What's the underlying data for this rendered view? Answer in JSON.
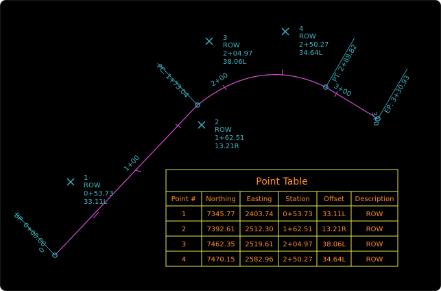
{
  "colors": {
    "background": "#000000",
    "frame": "#1a1a1a",
    "alignment": "#d94fd6",
    "label": "#3fb8c4",
    "table_border": "#e8e84a",
    "table_text": "#ff8c28"
  },
  "alignment": {
    "begin_label": "BP: 0+00.00",
    "begin_zero": "0",
    "pc_label": "PC: 1+73.04",
    "pt_label": "PT: 2+88.82",
    "ep_label": "EP: 3+30.93",
    "pt_tick_label": "3+00",
    "ep_tick_label": "3+0",
    "tick_labels": [
      "1+00",
      "2+00"
    ]
  },
  "points": [
    {
      "num": "1",
      "desc": "ROW",
      "station": "0+53.73",
      "offset": "33.11L"
    },
    {
      "num": "2",
      "desc": "ROW",
      "station": "1+62.51",
      "offset": "13.21R"
    },
    {
      "num": "3",
      "desc": "ROW",
      "station": "2+04.97",
      "offset": "38.06L"
    },
    {
      "num": "4",
      "desc": "ROW",
      "station": "2+50.27",
      "offset": "34.64L"
    }
  ],
  "point_table": {
    "title": "Point Table",
    "headers": [
      "Point #",
      "Northing",
      "Easting",
      "Station",
      "Offset",
      "Description"
    ],
    "rows": [
      [
        "1",
        "7345.77",
        "2403.74",
        "0+53.73",
        "33.11L",
        "ROW"
      ],
      [
        "2",
        "7392.61",
        "2512.30",
        "1+62.51",
        "13.21R",
        "ROW"
      ],
      [
        "3",
        "7462.35",
        "2519.61",
        "2+04.97",
        "38.06L",
        "ROW"
      ],
      [
        "4",
        "7470.15",
        "2582.96",
        "2+50.27",
        "34.64L",
        "ROW"
      ]
    ]
  }
}
